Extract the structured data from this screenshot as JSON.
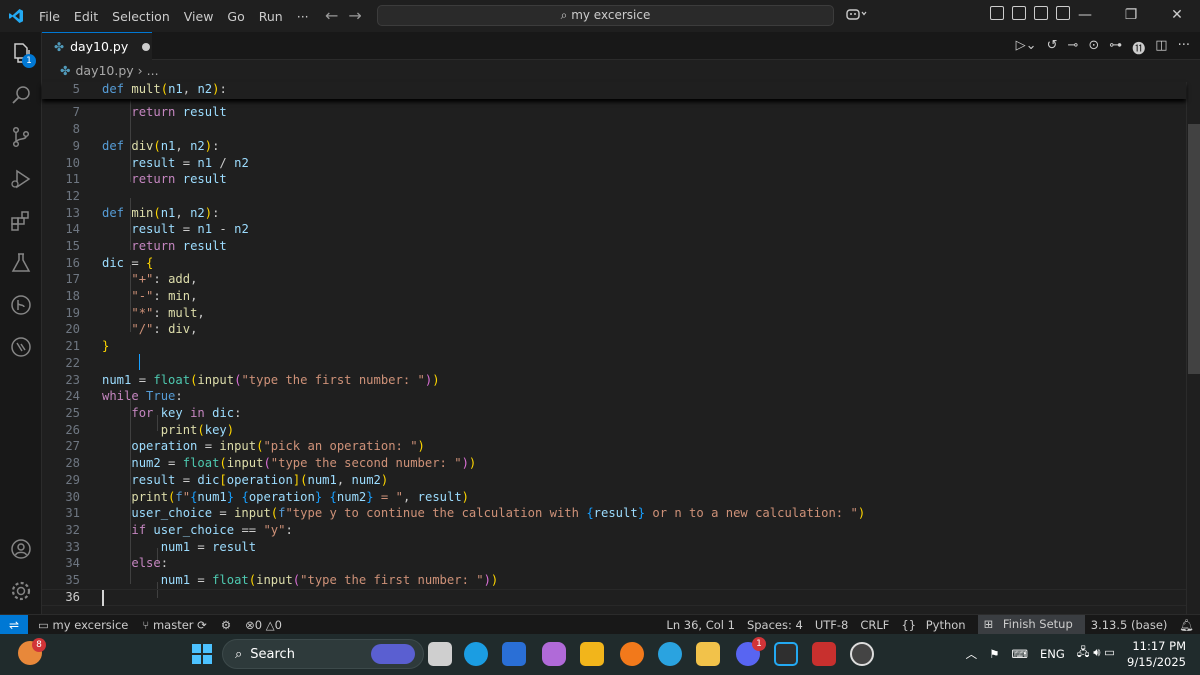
{
  "titlebar": {
    "menu": [
      "File",
      "Edit",
      "Selection",
      "View",
      "Go",
      "Run",
      "···"
    ],
    "search_text": "my excersice"
  },
  "tab": {
    "label": "day10.py"
  },
  "breadcrumb": {
    "file": "day10.py",
    "more": "..."
  },
  "editor": {
    "sticky": {
      "num": "5",
      "text": "def mult(n1, n2):"
    },
    "lines": [
      {
        "num": "7"
      },
      {
        "num": "8"
      },
      {
        "num": "9"
      },
      {
        "num": "10"
      },
      {
        "num": "11"
      },
      {
        "num": "12"
      },
      {
        "num": "13"
      },
      {
        "num": "14"
      },
      {
        "num": "15"
      },
      {
        "num": "16"
      },
      {
        "num": "17"
      },
      {
        "num": "18"
      },
      {
        "num": "19"
      },
      {
        "num": "20"
      },
      {
        "num": "21"
      },
      {
        "num": "22"
      },
      {
        "num": "23"
      },
      {
        "num": "24"
      },
      {
        "num": "25"
      },
      {
        "num": "26"
      },
      {
        "num": "27"
      },
      {
        "num": "28"
      },
      {
        "num": "29"
      },
      {
        "num": "30"
      },
      {
        "num": "31"
      },
      {
        "num": "32"
      },
      {
        "num": "33"
      },
      {
        "num": "34"
      },
      {
        "num": "35"
      },
      {
        "num": "36"
      }
    ]
  },
  "statusbar": {
    "workspace": "my excersice",
    "branch": "master",
    "errors": "0",
    "warnings": "0",
    "position": "Ln 36, Col 1",
    "spaces": "Spaces: 4",
    "encoding": "UTF-8",
    "eol": "CRLF",
    "language": "Python",
    "finish_setup": "Finish Setup",
    "interpreter": "3.13.5 (base)"
  },
  "taskbar": {
    "weather_badge": "8",
    "search_label": "Search",
    "discord_badge": "1",
    "lang": "ENG",
    "time": "11:17 PM",
    "date": "9/15/2025"
  },
  "colors": {
    "accent": "#0078d4",
    "background": "#1f1f1f"
  }
}
